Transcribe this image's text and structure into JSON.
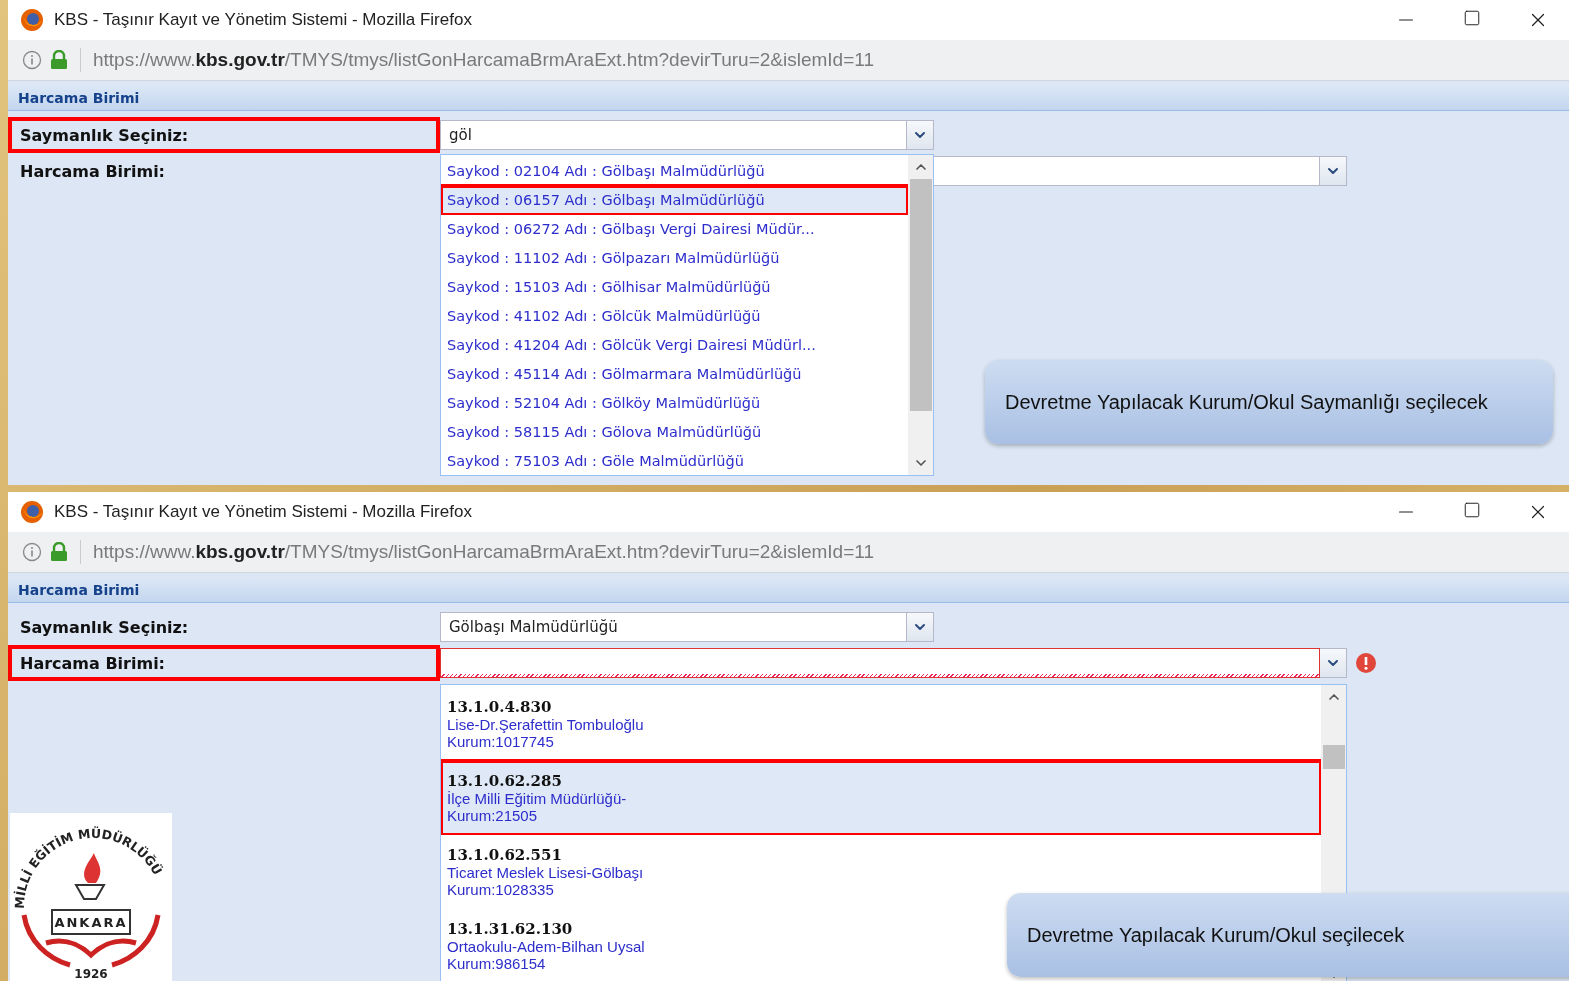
{
  "windows": [
    {
      "title": "KBS - Taşınır Kayıt ve Yönetim Sistemi - Mozilla Firefox",
      "url": "https://www.**kbs.gov.tr**/TMYS/tmys/listGonHarcamaBrmAraExt.htm?devirTuru=2&islemId=11",
      "section_title": "Harcama Birimi",
      "fields": [
        {
          "label": "Saymanlık Seçiniz:",
          "value": "göl",
          "highlighted": true,
          "invalid": false
        },
        {
          "label": "Harcama Birimi:",
          "highlighted": false,
          "invalid": false
        }
      ],
      "dropdown": {
        "kind": "simple",
        "items": [
          {
            "text": "Saykod : 02104 Adı : Gölbaşı Malmüdürlüğü",
            "selected": false,
            "highlighted": false
          },
          {
            "text": "Saykod : 06157 Adı : Gölbaşı Malmüdürlüğü",
            "selected": true,
            "highlighted": true
          },
          {
            "text": "Saykod : 06272 Adı : Gölbaşı Vergi Dairesi Müdür...",
            "selected": false,
            "highlighted": false
          },
          {
            "text": "Saykod : 11102 Adı : Gölpazarı Malmüdürlüğü",
            "selected": false,
            "highlighted": false
          },
          {
            "text": "Saykod : 15103 Adı : Gölhisar Malmüdürlüğü",
            "selected": false,
            "highlighted": false
          },
          {
            "text": "Saykod : 41102 Adı : Gölcük Malmüdürlüğü",
            "selected": false,
            "highlighted": false
          },
          {
            "text": "Saykod : 41204 Adı : Gölcük Vergi Dairesi Müdürl...",
            "selected": false,
            "highlighted": false
          },
          {
            "text": "Saykod : 45114 Adı : Gölmarmara Malmüdürlüğü",
            "selected": false,
            "highlighted": false
          },
          {
            "text": "Saykod : 52104 Adı : Gölköy Malmüdürlüğü",
            "selected": false,
            "highlighted": false
          },
          {
            "text": "Saykod : 58115 Adı : Gölova Malmüdürlüğü",
            "selected": false,
            "highlighted": false
          },
          {
            "text": "Saykod : 75103 Adı : Göle Malmüdürlüğü",
            "selected": false,
            "highlighted": false
          }
        ]
      }
    },
    {
      "title": "KBS - Taşınır Kayıt ve Yönetim Sistemi - Mozilla Firefox",
      "url": "https://www.**kbs.gov.tr**/TMYS/tmys/listGonHarcamaBrmAraExt.htm?devirTuru=2&islemId=11",
      "section_title": "Harcama Birimi",
      "fields": [
        {
          "label": "Saymanlık Seçiniz:",
          "value": "Gölbaşı Malmüdürlüğü",
          "highlighted": false,
          "invalid": false
        },
        {
          "label": "Harcama Birimi:",
          "highlighted": true,
          "invalid": true
        }
      ],
      "dropdown": {
        "kind": "detailed",
        "items": [
          {
            "code": "13.1.0.4.830",
            "name": "Lise-Dr.Şerafettin Tombuloğlu",
            "kurum": "Kurum:1017745",
            "selected": false,
            "highlighted": false
          },
          {
            "code": "13.1.0.62.285",
            "name": "İlçe Milli Eğitim Müdürlüğü-",
            "kurum": "Kurum:21505",
            "selected": true,
            "highlighted": true
          },
          {
            "code": "13.1.0.62.551",
            "name": "Ticaret Meslek Lisesi-Gölbaşı",
            "kurum": "Kurum:1028335",
            "selected": false,
            "highlighted": false
          },
          {
            "code": "13.1.31.62.130",
            "name": "Ortaokulu-Adem-Bilhan Uysal",
            "kurum": "Kurum:986154",
            "selected": false,
            "highlighted": false
          }
        ]
      }
    }
  ],
  "callouts": [
    "Devretme Yapılacak Kurum/Okul Saymanlığı seçilecek",
    "Devretme Yapılacak Kurum/Okul seçilecek"
  ],
  "logo": {
    "arc_text": "MİLLİ EĞİTİM MÜDÜRLÜĞÜ",
    "center_text": "ANKARA",
    "year": "1926"
  }
}
